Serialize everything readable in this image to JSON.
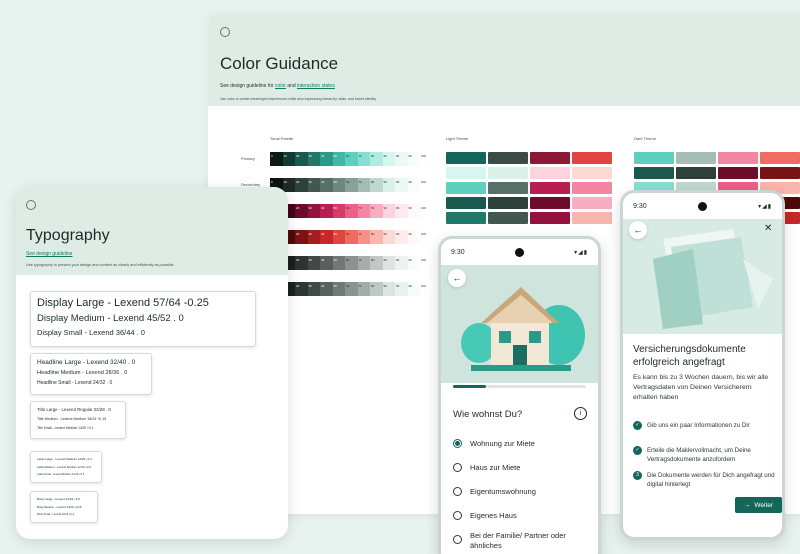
{
  "color_guidance": {
    "title": "Color Guidance",
    "intro_prefix": "See design guideline for",
    "link_color": "color",
    "and": "and",
    "link_interaction": "interaction states",
    "description": "Use color to create meaningful experiences while also expressing hierarchy, state, and brand identity.",
    "tonal_palette_title": "Tonal Palette",
    "light_theme_title": "Light Theme",
    "dark_theme_title": "Dark Theme",
    "row_primary": "Primary",
    "row_secondary": "Secondary",
    "tone_labels": [
      "0",
      "10",
      "20",
      "30",
      "40",
      "50",
      "60",
      "70",
      "80",
      "90",
      "95",
      "99",
      "100"
    ],
    "colors": {
      "primary_row": [
        "#0a1a17",
        "#123a33",
        "#1a5a4e",
        "#20786a",
        "#2c9a88",
        "#3fb8a5",
        "#5fd0bf",
        "#86e0d2",
        "#b0ece2",
        "#d6f6f0",
        "#eafbf7",
        "#f6fefc",
        "#ffffff"
      ],
      "secondary_row": [
        "#0d1311",
        "#1d2a26",
        "#2e403a",
        "#415750",
        "#566f67",
        "#6e8880",
        "#88a29a",
        "#a4bdb5",
        "#c0d8d0",
        "#dcf0ea",
        "#ecf8f4",
        "#f8fdfb",
        "#ffffff"
      ],
      "tertiary_row": [
        "#1c0208",
        "#44061a",
        "#6c0c2a",
        "#93133c",
        "#b81e50",
        "#d63a69",
        "#ec5f86",
        "#f586a3",
        "#f9adc0",
        "#fcd3de",
        "#fde9ee",
        "#fff8f9",
        "#ffffff"
      ],
      "error_row": [
        "#1f0000",
        "#4e0a0a",
        "#7a1414",
        "#a21d1d",
        "#c62828",
        "#e0453f",
        "#f06b62",
        "#f69189",
        "#fab5ad",
        "#fdd9d4",
        "#feecea",
        "#fffaf9",
        "#ffffff"
      ],
      "neutral_row": [
        "#0c0e0d",
        "#1c1f1e",
        "#2f3331",
        "#434846",
        "#5a5f5d",
        "#727876",
        "#8c9290",
        "#a8adab",
        "#c3c8c6",
        "#dfe3e1",
        "#eef1f0",
        "#fafcfb",
        "#ffffff"
      ],
      "neutral_variant_row": [
        "#0b100e",
        "#1a221f",
        "#2c3632",
        "#3f4b47",
        "#56625e",
        "#6d7a76",
        "#87948f",
        "#a2aeaa",
        "#bdc9c5",
        "#d9e5e1",
        "#e8f3ef",
        "#f5fcf9",
        "#ffffff"
      ],
      "light_theme_cells": [
        "#14665a",
        "#3c4a46",
        "#8e1738",
        "#e0453f",
        "#d6f6f0",
        "#dcf0ea",
        "#fcd3de",
        "#fdd9d4",
        "#5fd0bf",
        "#566f67",
        "#b81e50",
        "#f586a3",
        "#1a5a4e",
        "#2e403a",
        "#6c0c2a",
        "#f9adc0",
        "#20786a",
        "#415750",
        "#93133c",
        "#fab5ad"
      ],
      "dark_theme_cells": [
        "#5fd0bf",
        "#a4bdb5",
        "#f586a3",
        "#f06b62",
        "#1a5a4e",
        "#2e403a",
        "#6c0c2a",
        "#7a1414",
        "#86e0d2",
        "#c0d8d0",
        "#ec5f86",
        "#fab5ad",
        "#123a33",
        "#1d2a26",
        "#44061a",
        "#4e0a0a",
        "#b0ece2",
        "#dcf0ea",
        "#f9adc0",
        "#c62828"
      ]
    }
  },
  "typography": {
    "title": "Typography",
    "link": "See design guideline",
    "description": "Use typography to present your design and content as clearly and efficiently as possible.",
    "display_large": "Display Large - Lexend 57/64 -0.25",
    "display_medium": "Display Medium - Lexend 45/52 .  0",
    "display_small": "Display Small - Lexend 36/44 . 0",
    "headline_large": "Headline Large - Lexend 32/40 . 0",
    "headline_medium": "Headline Medium - Lexend 28/36 . 0",
    "headline_small": "Headline Small - Lexend 24/32 . 0",
    "title_large": "Title Large - Lexend Regular 22/28 . 0",
    "title_medium": "Title Medium - Lexend Medium 16/24  +0.15",
    "title_small": "Title Small - Lexend Medium 14/20  +0.1",
    "label_large": "Label Large - Lexend Medium 14/20  +0.1",
    "label_medium": "Label Medium - Lexend Medium 12/16  +0.5",
    "label_small": "Label Small - Lexend Medium 11/16  +0.5",
    "body_large": "Body Large - Lexend 16/24  +0.5",
    "body_medium": "Body Medium - Lexend 14/20  +0.25",
    "body_small": "Body Small - Lexend 12/16  +0.4"
  },
  "phone_questionnaire": {
    "time": "9:30",
    "status_icons": "▾◢▮",
    "back_icon": "←",
    "progress_fraction": 0.25,
    "question": "Wie wohnst Du?",
    "info_icon": "i",
    "options": [
      {
        "label": "Wohnung zur Miete",
        "selected": true
      },
      {
        "label": "Haus zur Miete",
        "selected": false
      },
      {
        "label": "Eigentumswohnung",
        "selected": false
      },
      {
        "label": "Eigenes Haus",
        "selected": false
      },
      {
        "label": "Bei der Familie/ Partner oder ähnliches",
        "selected": false
      }
    ]
  },
  "phone_confirmation": {
    "time": "9:30",
    "status_icons": "▾◢▮",
    "back_icon": "←",
    "close_icon": "✕",
    "title": "Versicherungsdokumente erfolgreich angefragt",
    "body": "Es kann bis zu 3 Wochen dauern, bis wir alle Vertragsdaten von Deinen Versicherern erhalten haben",
    "steps": [
      {
        "badge": "✓",
        "text": "Gib uns ein paar Informationen zu Dir"
      },
      {
        "badge": "✓",
        "text": "Erteile die Maklervollmacht, um Deine Vertragsdokumente anzufordern"
      },
      {
        "badge": "3",
        "text": "Die Dokumente werden für Dich angefragt und digital hinterlegt"
      }
    ],
    "next_label": "Weiter",
    "next_icon": "→"
  },
  "accent": "#14665a"
}
